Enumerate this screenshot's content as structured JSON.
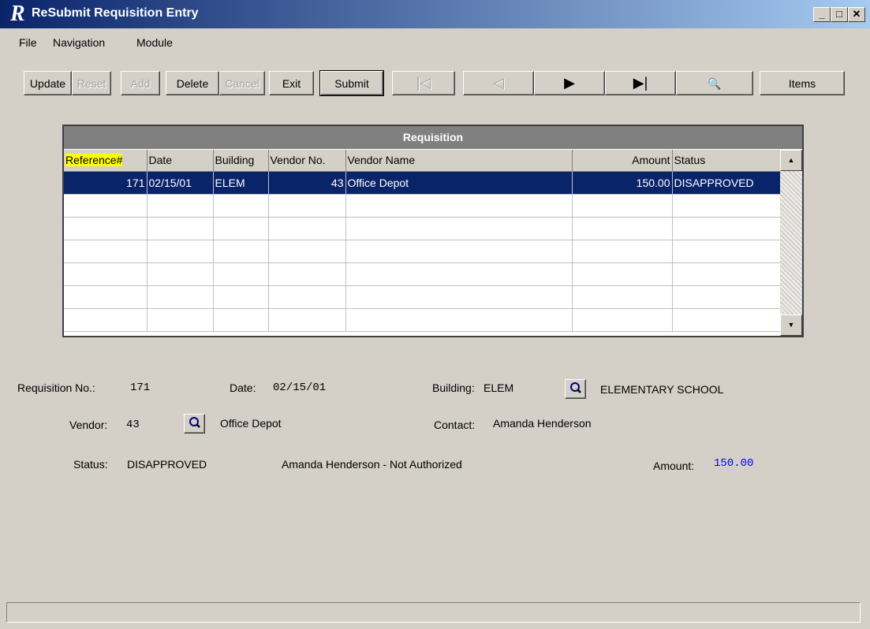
{
  "window": {
    "icon_letter": "R",
    "title": "ReSubmit Requisition Entry",
    "minimize": "_",
    "maximize": "□",
    "close": "✕"
  },
  "menu": [
    "File",
    "Navigation",
    "Module"
  ],
  "toolbar": {
    "update": "Update",
    "reset": "Reset",
    "add": "Add",
    "delete": "Delete",
    "cancel": "Cancel",
    "exit": "Exit",
    "submit": "Submit",
    "first": "|◁",
    "prev": "◁",
    "next": "▶",
    "last": "▶|",
    "find": "🔍",
    "items": "Items"
  },
  "grid": {
    "caption": "Requisition",
    "columns": [
      "Reference#",
      "Date",
      "Building",
      "Vendor No.",
      "Vendor Name",
      "Amount",
      "Status"
    ],
    "rows": [
      [
        "171",
        "02/15/01",
        "ELEM",
        "43",
        "Office Depot",
        "150.00",
        "DISAPPROVED"
      ]
    ],
    "scroll_up": "▲",
    "scroll_down": "▼"
  },
  "details": {
    "requisition_no_label": "Requisition No.:",
    "requisition_no": "171",
    "date_label": "Date:",
    "date": "02/15/01",
    "building_label": "Building:",
    "building": "ELEM",
    "building_name": "ELEMENTARY SCHOOL",
    "vendor_label": "Vendor:",
    "vendor": "43",
    "vendor_name": "Office Depot",
    "contact_label": "Contact:",
    "contact": "Amanda Henderson",
    "status_label": "Status:",
    "status": "DISAPPROVED",
    "status_note": "Amanda Henderson - Not Authorized",
    "amount_label": "Amount:",
    "amount": "150.00"
  },
  "colors": {
    "title_bar": "#0a246a",
    "selection": "#0a246a",
    "highlight": "#ffff00",
    "amount_text": "#0000ff"
  }
}
